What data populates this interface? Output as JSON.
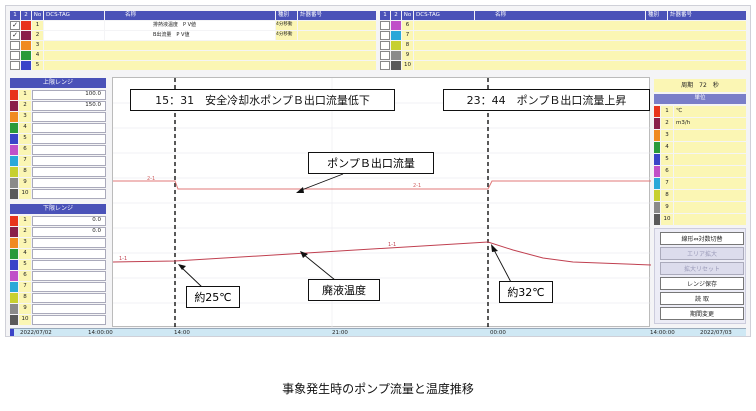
{
  "top_table_left": {
    "headers": [
      "1",
      "2",
      "No",
      "DCS-TAG",
      "名称",
      "種別",
      "計器番号"
    ],
    "rows": [
      {
        "no": "1",
        "checked": true,
        "name": "排熱液温度　P V値",
        "type": "4分移動"
      },
      {
        "no": "2",
        "checked": true,
        "name": "B出流量　P V値",
        "type": "4分移動"
      },
      {
        "no": "3",
        "checked": false,
        "name": "",
        "type": ""
      },
      {
        "no": "4",
        "checked": false,
        "name": "",
        "type": ""
      },
      {
        "no": "5",
        "checked": false,
        "name": "",
        "type": ""
      }
    ]
  },
  "top_table_right": {
    "headers": [
      "1",
      "2",
      "No",
      "DCS-TAG",
      "名称",
      "種別",
      "計器番号"
    ],
    "rows": [
      {
        "no": "6"
      },
      {
        "no": "7"
      },
      {
        "no": "8"
      },
      {
        "no": "9"
      },
      {
        "no": "10"
      }
    ]
  },
  "upper_range": {
    "title": "上限レンジ",
    "rows": [
      {
        "no": "1",
        "value": "100.0"
      },
      {
        "no": "2",
        "value": "150.0"
      },
      {
        "no": "3",
        "value": ""
      },
      {
        "no": "4",
        "value": ""
      },
      {
        "no": "5",
        "value": ""
      },
      {
        "no": "6",
        "value": ""
      },
      {
        "no": "7",
        "value": ""
      },
      {
        "no": "8",
        "value": ""
      },
      {
        "no": "9",
        "value": ""
      },
      {
        "no": "10",
        "value": ""
      }
    ]
  },
  "lower_range": {
    "title": "下限レンジ",
    "rows": [
      {
        "no": "1",
        "value": "0.0"
      },
      {
        "no": "2",
        "value": "0.0"
      },
      {
        "no": "3",
        "value": ""
      },
      {
        "no": "4",
        "value": ""
      },
      {
        "no": "5",
        "value": ""
      },
      {
        "no": "6",
        "value": ""
      },
      {
        "no": "7",
        "value": ""
      },
      {
        "no": "8",
        "value": ""
      },
      {
        "no": "9",
        "value": ""
      },
      {
        "no": "10",
        "value": ""
      }
    ]
  },
  "period": {
    "label": "周期",
    "value": "72",
    "unit": "秒"
  },
  "unit_panel": {
    "title": "単位",
    "rows": [
      {
        "no": "1",
        "unit": "℃"
      },
      {
        "no": "2",
        "unit": "m3/h"
      },
      {
        "no": "3",
        "unit": ""
      },
      {
        "no": "4",
        "unit": ""
      },
      {
        "no": "5",
        "unit": ""
      },
      {
        "no": "6",
        "unit": ""
      },
      {
        "no": "7",
        "unit": ""
      },
      {
        "no": "8",
        "unit": ""
      },
      {
        "no": "9",
        "unit": ""
      },
      {
        "no": "10",
        "unit": ""
      }
    ]
  },
  "row_colors": [
    "#e8341c",
    "#8a1f4a",
    "#f08a20",
    "#2a9a3a",
    "#3a44c8",
    "#c050c8",
    "#2aa8d8",
    "#c7d030",
    "#8a8a8a",
    "#5a5a5a"
  ],
  "buttons": [
    {
      "label": "線形⇔対数切替",
      "enabled": true
    },
    {
      "label": "エリア拡大",
      "enabled": false
    },
    {
      "label": "拡大リセット",
      "enabled": false
    },
    {
      "label": "レンジ保存",
      "enabled": true
    },
    {
      "label": "読 取",
      "enabled": true
    },
    {
      "label": "期間変更",
      "enabled": true
    }
  ],
  "annotations": {
    "event1": "15：31　安全冷却水ポンプＢ出口流量低下",
    "event2": "23：44　ポンプＢ出口流量上昇",
    "flow_label": "ポンプＢ出口流量",
    "temp_label": "廃液温度",
    "temp1": "約25℃",
    "temp2": "約32℃"
  },
  "trend_labels": {
    "flow": "2-1",
    "temp": "1-1"
  },
  "time_axis": {
    "start_date": "2022/07/02",
    "start_time": "14:00:00",
    "ticks": [
      "14:00",
      "21:00",
      "00:00"
    ],
    "end_time": "14:00:00",
    "end_date": "2022/07/03"
  },
  "caption": "事象発生時のポンプ流量と温度推移"
}
